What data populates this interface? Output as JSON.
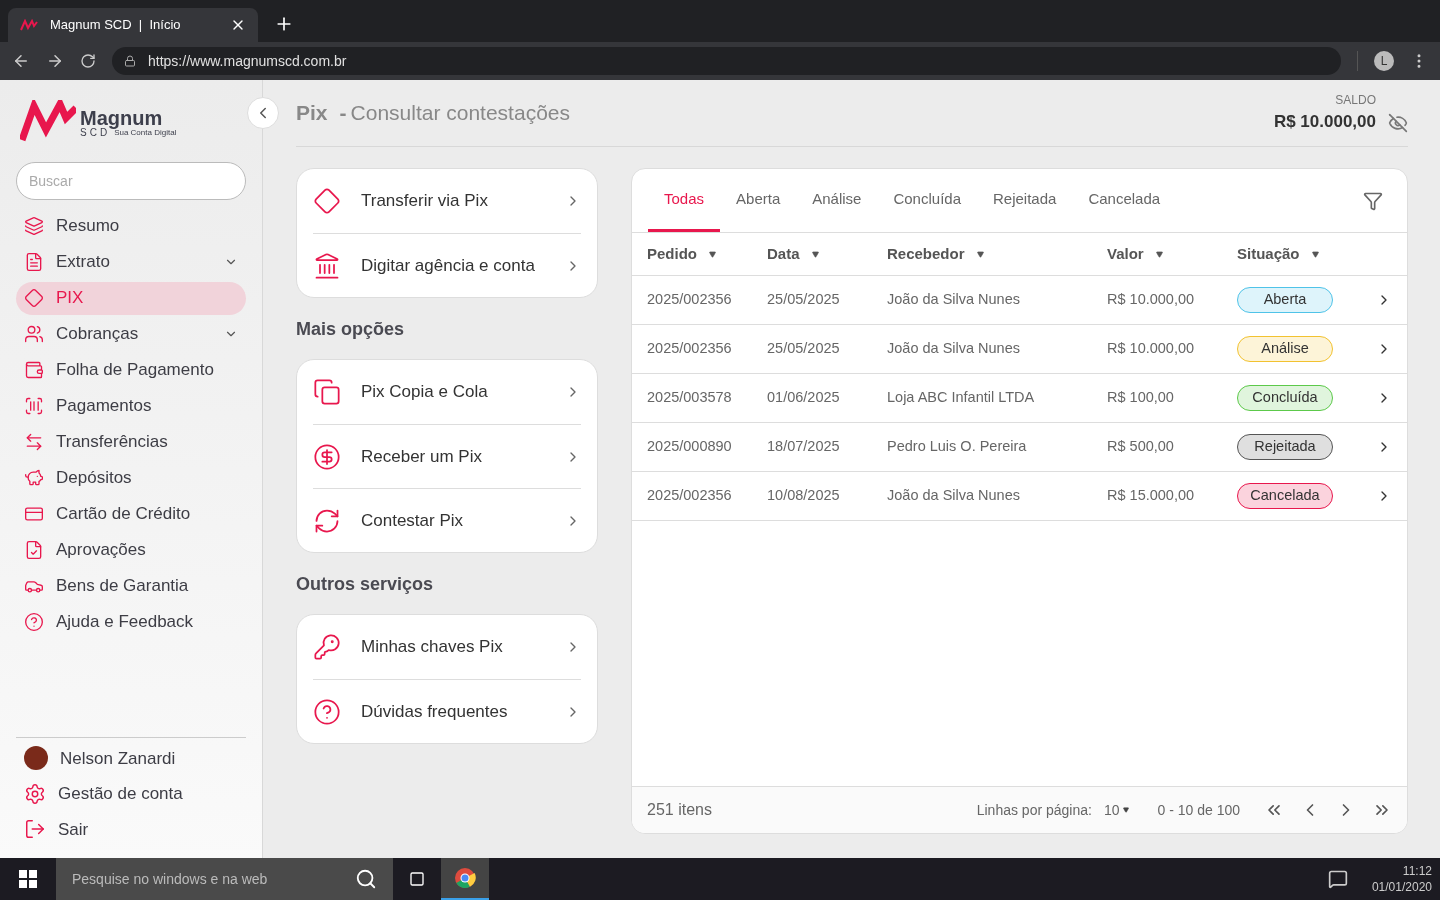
{
  "browser": {
    "tab_title": "Magnum SCD  |  Início",
    "url": "https://www.magnumscd.com.br",
    "profile": "L"
  },
  "logo": {
    "name": "Magnum",
    "sub": "SCD",
    "tagline": "Sua Conta Digital"
  },
  "sidebar": {
    "search": {
      "placeholder": "Buscar"
    },
    "items": [
      {
        "label": "Resumo",
        "selected": false,
        "expandable": false
      },
      {
        "label": "Extrato",
        "selected": false,
        "expandable": true
      },
      {
        "label": "PIX",
        "selected": true,
        "expandable": false
      },
      {
        "label": "Cobranças",
        "selected": false,
        "expandable": true
      },
      {
        "label": "Folha de Pagamento",
        "selected": false,
        "expandable": false
      },
      {
        "label": "Pagamentos",
        "selected": false,
        "expandable": false
      },
      {
        "label": "Transferências",
        "selected": false,
        "expandable": false
      },
      {
        "label": "Depósitos",
        "selected": false,
        "expandable": false
      },
      {
        "label": "Cartão de Crédito",
        "selected": false,
        "expandable": false
      },
      {
        "label": "Aprovações",
        "selected": false,
        "expandable": false
      },
      {
        "label": "Bens de Garantia",
        "selected": false,
        "expandable": false
      },
      {
        "label": "Ajuda e Feedback",
        "selected": false,
        "expandable": false
      }
    ],
    "user": "Nelson Zanardi",
    "account": "Gestão de conta",
    "logout": "Sair"
  },
  "header": {
    "section": "Pix",
    "separator": "-",
    "title": "Consultar contestações",
    "balance_label": "SALDO",
    "balance": "R$ 10.000,00"
  },
  "menu_groups": [
    {
      "items": [
        "Transferir via Pix",
        "Digitar agência e conta"
      ]
    },
    {
      "title": "Mais opções",
      "items": [
        "Pix Copia e Cola",
        "Receber um Pix",
        "Contestar Pix"
      ]
    },
    {
      "title": "Outros serviços",
      "items": [
        "Minhas chaves Pix",
        "Dúvidas frequentes"
      ]
    }
  ],
  "tabs": [
    {
      "label": "Todas",
      "selected": true
    },
    {
      "label": "Aberta",
      "selected": false
    },
    {
      "label": "Análise",
      "selected": false
    },
    {
      "label": "Concluída",
      "selected": false
    },
    {
      "label": "Rejeitada",
      "selected": false
    },
    {
      "label": "Cancelada",
      "selected": false
    }
  ],
  "table": {
    "columns": [
      "Pedido",
      "Data",
      "Recebedor",
      "Valor",
      "Situação"
    ],
    "rows": [
      {
        "pedido": "2025/002356",
        "data": "25/05/2025",
        "recebedor": "João da Silva Nunes",
        "valor": "R$ 10.000,00",
        "situacao": "Aberta",
        "color": "#4fc3e8"
      },
      {
        "pedido": "2025/002356",
        "data": "25/05/2025",
        "recebedor": "João da Silva Nunes",
        "valor": "R$ 10.000,00",
        "situacao": "Análise",
        "color": "#f2c230"
      },
      {
        "pedido": "2025/003578",
        "data": "01/06/2025",
        "recebedor": "Loja ABC Infantil LTDA",
        "valor": "R$ 100,00",
        "situacao": "Concluída",
        "color": "#5cc94a"
      },
      {
        "pedido": "2025/000890",
        "data": "18/07/2025",
        "recebedor": "Pedro Luis O. Pereira",
        "valor": "R$ 500,00",
        "situacao": "Rejeitada",
        "color": "#555555"
      },
      {
        "pedido": "2025/002356",
        "data": "10/08/2025",
        "recebedor": "João da Silva Nunes",
        "valor": "R$ 15.000,00",
        "situacao": "Cancelada",
        "color": "#e8174d"
      }
    ]
  },
  "pagination": {
    "total": "251 itens",
    "rows_label": "Linhas por página:",
    "rows_value": "10",
    "range": "0 - 10 de 100"
  },
  "taskbar": {
    "search_placeholder": "Pesquise no windows e na web",
    "time": "11:12",
    "date": "01/01/2020"
  }
}
